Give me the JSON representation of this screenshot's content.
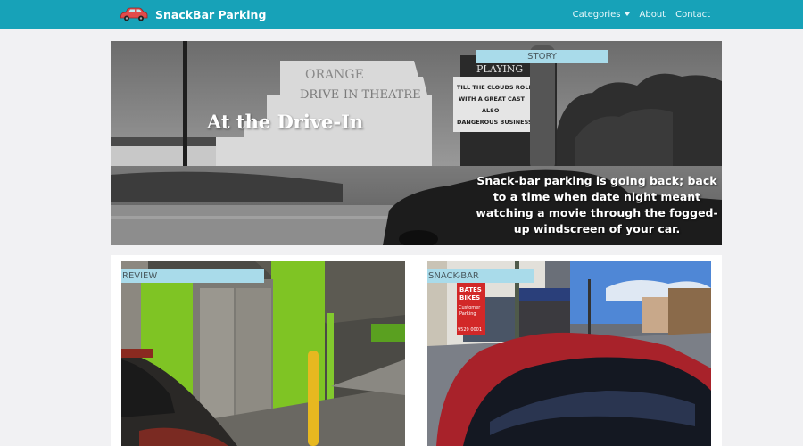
{
  "brand": {
    "name": "SnackBar Parking",
    "logo_icon": "car-icon",
    "logo_color": "#e24b4b"
  },
  "nav": {
    "categories": "Categories",
    "about": "About",
    "contact": "Contact"
  },
  "hero": {
    "tag": "STORY",
    "title": "At the Drive-In",
    "text": "Snack-bar parking is going back; back to a time when date night meant watching a movie through the fogged-up windscreen of your car.",
    "image_sign_brand": "ORANGE",
    "image_sign_name": "DRIVE-IN THEATRE",
    "marquee": [
      "PLAYING",
      "TILL THE CLOUDS ROLL BY",
      "WITH A GREAT CAST",
      "ALSO",
      "DANGEROUS BUSINESS"
    ]
  },
  "cards": [
    {
      "tag": "REVIEW"
    },
    {
      "tag": "SNACK-BAR",
      "image_sign": [
        "BATES",
        "BIKES",
        "Customer",
        "Parking",
        "9529 0001"
      ]
    }
  ],
  "colors": {
    "navbar": "#17a2b8",
    "tag_bg": "#a9dbea",
    "page_bg": "#f1f1f3"
  }
}
